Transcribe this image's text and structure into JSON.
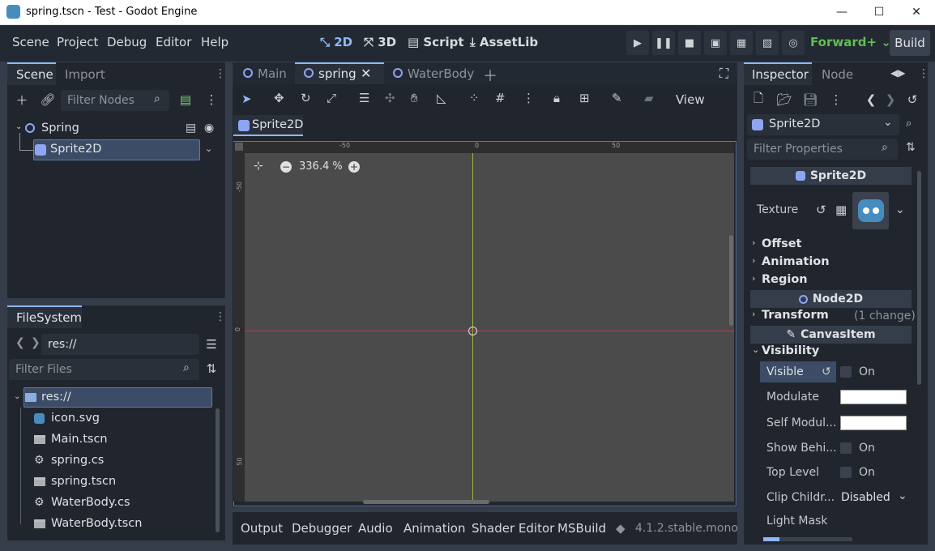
{
  "window": {
    "title": "spring.tscn - Test - Godot Engine",
    "minimize": "—",
    "maximize": "☐",
    "close": "✕"
  },
  "menu": [
    "Scene",
    "Project",
    "Debug",
    "Editor",
    "Help"
  ],
  "workspaces": [
    {
      "icon": "2d-icon",
      "label": "2D",
      "active": true
    },
    {
      "icon": "3d-icon",
      "label": "3D",
      "active": false
    },
    {
      "icon": "script-icon",
      "label": "Script",
      "active": false
    },
    {
      "icon": "assetlib-icon",
      "label": "AssetLib",
      "active": false
    }
  ],
  "renderer": "Forward+",
  "build_label": "Build",
  "scene_dock": {
    "tabs": [
      "Scene",
      "Import"
    ],
    "filter_placeholder": "Filter Nodes",
    "tree": [
      {
        "label": "Spring"
      },
      {
        "label": "Sprite2D"
      }
    ]
  },
  "filesystem": {
    "tab": "FileSystem",
    "path": "res://",
    "filter_placeholder": "Filter Files",
    "root": "res://",
    "files": [
      "icon.svg",
      "Main.tscn",
      "spring.cs",
      "spring.tscn",
      "WaterBody.cs",
      "WaterBody.tscn"
    ]
  },
  "editor_tabs": [
    "Main",
    "spring",
    "WaterBody"
  ],
  "breadcrumb": "Sprite2D",
  "view_menu": "View",
  "zoom": "336.4 %",
  "ruler": {
    "h": [
      "-50",
      "0",
      "50"
    ],
    "v": [
      "-50",
      "0",
      "50"
    ]
  },
  "bottom_tabs": [
    "Output",
    "Debugger",
    "Audio",
    "Animation",
    "Shader Editor",
    "MSBuild"
  ],
  "version": "4.1.2.stable.mono",
  "inspector": {
    "tabs": [
      "Inspector",
      "Node"
    ],
    "node": "Sprite2D",
    "filter_placeholder": "Filter Properties",
    "class_header": "Sprite2D",
    "texture_label": "Texture",
    "groups1": [
      "Offset",
      "Animation",
      "Region"
    ],
    "node2d_header": "Node2D",
    "transform": "Transform",
    "transform_note": "(1 change)",
    "canvasitem_header": "CanvasItem",
    "visibility": "Visibility",
    "props": {
      "visible": "Visible",
      "visible_val": "On",
      "modulate": "Modulate",
      "self_modulate": "Self Modul...",
      "show_behind": "Show Behi...",
      "show_behind_val": "On",
      "top_level": "Top Level",
      "top_level_val": "On",
      "clip_children": "Clip Childr...",
      "clip_children_val": "Disabled",
      "light_mask": "Light Mask"
    }
  },
  "colors": {
    "accent": "#8eb8f5",
    "renderer": "#5fbf50",
    "axis_x": "#c0395a",
    "axis_y": "#98b63d"
  }
}
